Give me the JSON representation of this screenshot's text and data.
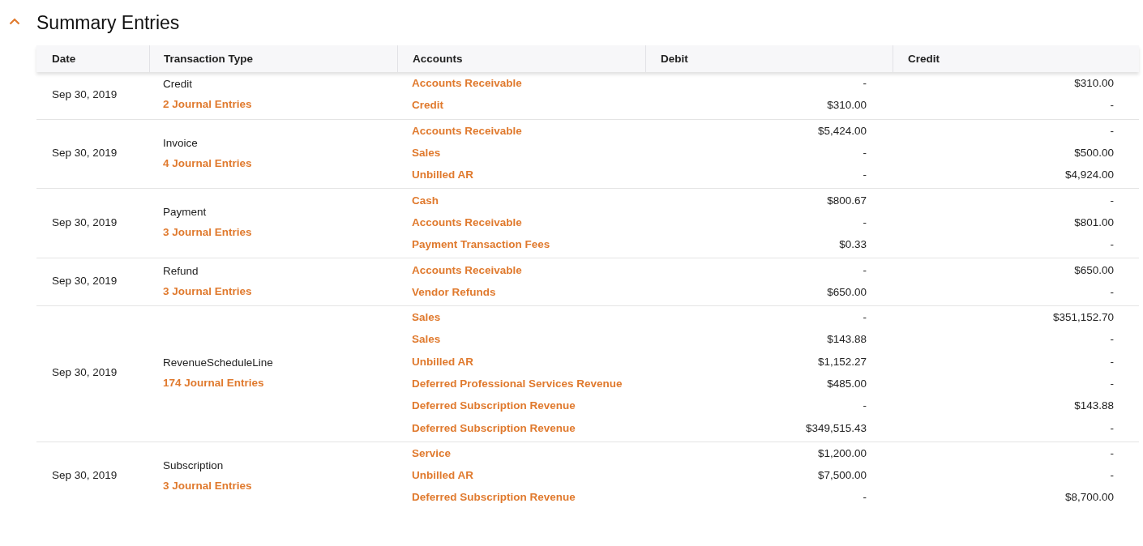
{
  "section": {
    "title": "Summary Entries",
    "expanded": true
  },
  "table": {
    "columns": [
      "Date",
      "Transaction Type",
      "Accounts",
      "Debit",
      "Credit"
    ],
    "rows": [
      {
        "date": "Sep 30, 2019",
        "type": "Credit",
        "journal_link": "2 Journal Entries",
        "entries": [
          {
            "account": "Accounts Receivable",
            "debit": "-",
            "credit": "$310.00"
          },
          {
            "account": "Credit",
            "debit": "$310.00",
            "credit": "-"
          }
        ]
      },
      {
        "date": "Sep 30, 2019",
        "type": "Invoice",
        "journal_link": "4 Journal Entries",
        "entries": [
          {
            "account": "Accounts Receivable",
            "debit": "$5,424.00",
            "credit": "-"
          },
          {
            "account": "Sales",
            "debit": "-",
            "credit": "$500.00"
          },
          {
            "account": "Unbilled AR",
            "debit": "-",
            "credit": "$4,924.00"
          }
        ]
      },
      {
        "date": "Sep 30, 2019",
        "type": "Payment",
        "journal_link": "3 Journal Entries",
        "entries": [
          {
            "account": "Cash",
            "debit": "$800.67",
            "credit": "-"
          },
          {
            "account": "Accounts Receivable",
            "debit": "-",
            "credit": "$801.00"
          },
          {
            "account": "Payment Transaction Fees",
            "debit": "$0.33",
            "credit": "-"
          }
        ]
      },
      {
        "date": "Sep 30, 2019",
        "type": "Refund",
        "journal_link": "3 Journal Entries",
        "entries": [
          {
            "account": "Accounts Receivable",
            "debit": "-",
            "credit": "$650.00"
          },
          {
            "account": "Vendor Refunds",
            "debit": "$650.00",
            "credit": "-"
          }
        ]
      },
      {
        "date": "Sep 30, 2019",
        "type": "RevenueScheduleLine",
        "journal_link": "174 Journal Entries",
        "entries": [
          {
            "account": "Sales",
            "debit": "-",
            "credit": "$351,152.70"
          },
          {
            "account": "Sales",
            "debit": "$143.88",
            "credit": "-"
          },
          {
            "account": "Unbilled AR",
            "debit": "$1,152.27",
            "credit": "-"
          },
          {
            "account": "Deferred Professional Services Revenue",
            "debit": "$485.00",
            "credit": "-"
          },
          {
            "account": "Deferred Subscription Revenue",
            "debit": "-",
            "credit": "$143.88"
          },
          {
            "account": "Deferred Subscription Revenue",
            "debit": "$349,515.43",
            "credit": "-"
          }
        ]
      },
      {
        "date": "Sep 30, 2019",
        "type": "Subscription",
        "journal_link": "3 Journal Entries",
        "entries": [
          {
            "account": "Service",
            "debit": "$1,200.00",
            "credit": "-"
          },
          {
            "account": "Unbilled AR",
            "debit": "$7,500.00",
            "credit": "-"
          },
          {
            "account": "Deferred Subscription Revenue",
            "debit": "-",
            "credit": "$8,700.00"
          }
        ]
      }
    ]
  }
}
